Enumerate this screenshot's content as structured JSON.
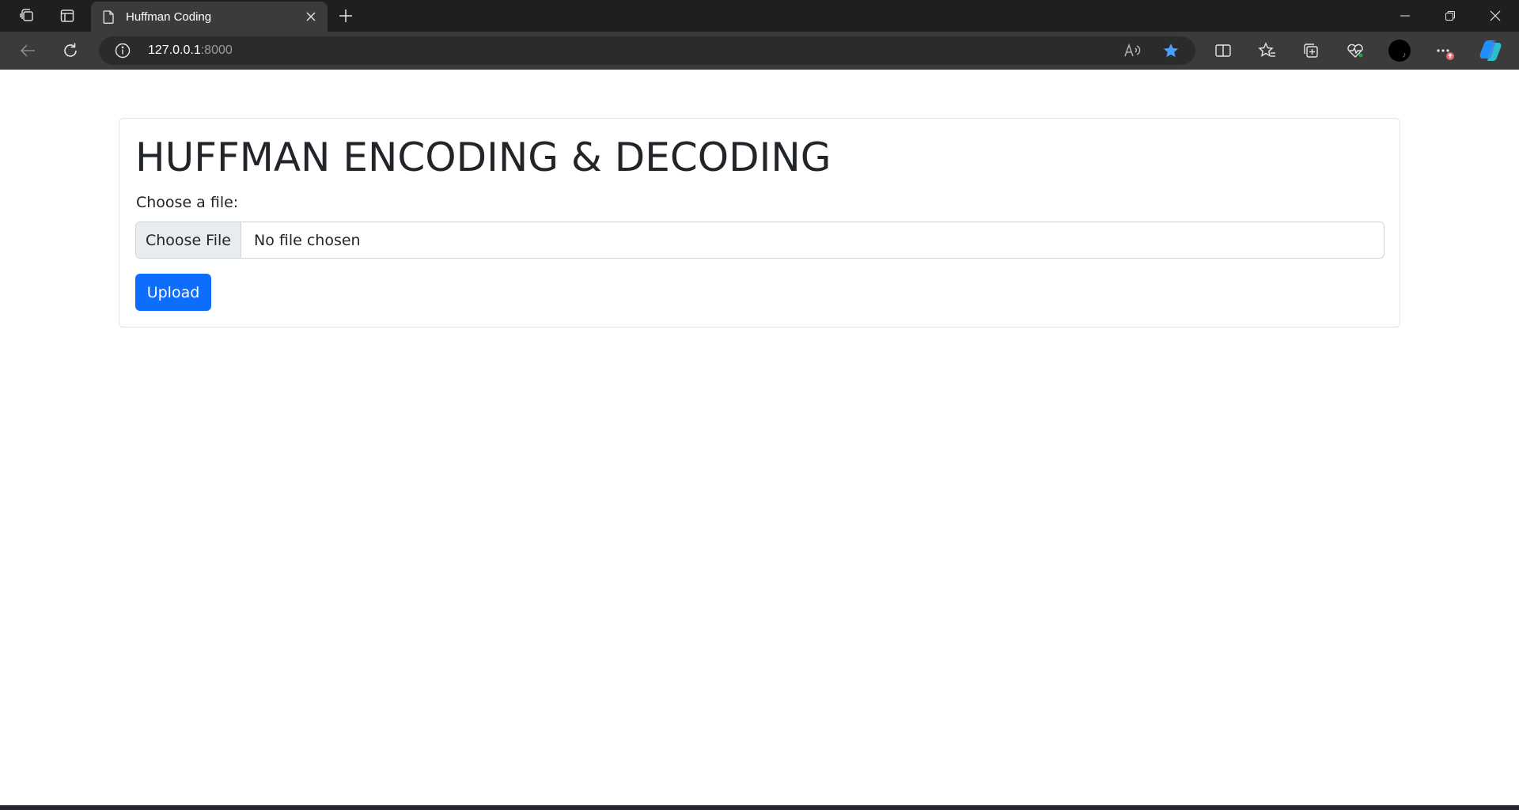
{
  "browser": {
    "tab": {
      "title": "Huffman Coding"
    },
    "address": {
      "host": "127.0.0.1",
      "port": ":8000"
    },
    "icons": [
      "workspaces-icon",
      "tab-actions-icon",
      "document-icon",
      "close-tab-icon",
      "new-tab-icon",
      "minimize-icon",
      "restore-icon",
      "close-window-icon",
      "back-icon",
      "refresh-icon",
      "info-icon",
      "read-aloud-icon",
      "favorite-star-icon",
      "split-screen-icon",
      "favorites-icon",
      "collections-icon",
      "browser-essentials-icon",
      "profile-avatar",
      "more-options-icon",
      "copilot-icon"
    ],
    "colors": {
      "star": "#4aa0ff",
      "tab_bg": "#3b3b3b",
      "titlebar_bg": "#1f1f1f"
    }
  },
  "page": {
    "heading": "HUFFMAN ENCODING & DECODING",
    "file_label": "Choose a file:",
    "choose_button": "Choose File",
    "no_file_text": "No file chosen",
    "upload_button": "Upload",
    "colors": {
      "primary": "#0d6efd",
      "text": "#212529"
    }
  }
}
